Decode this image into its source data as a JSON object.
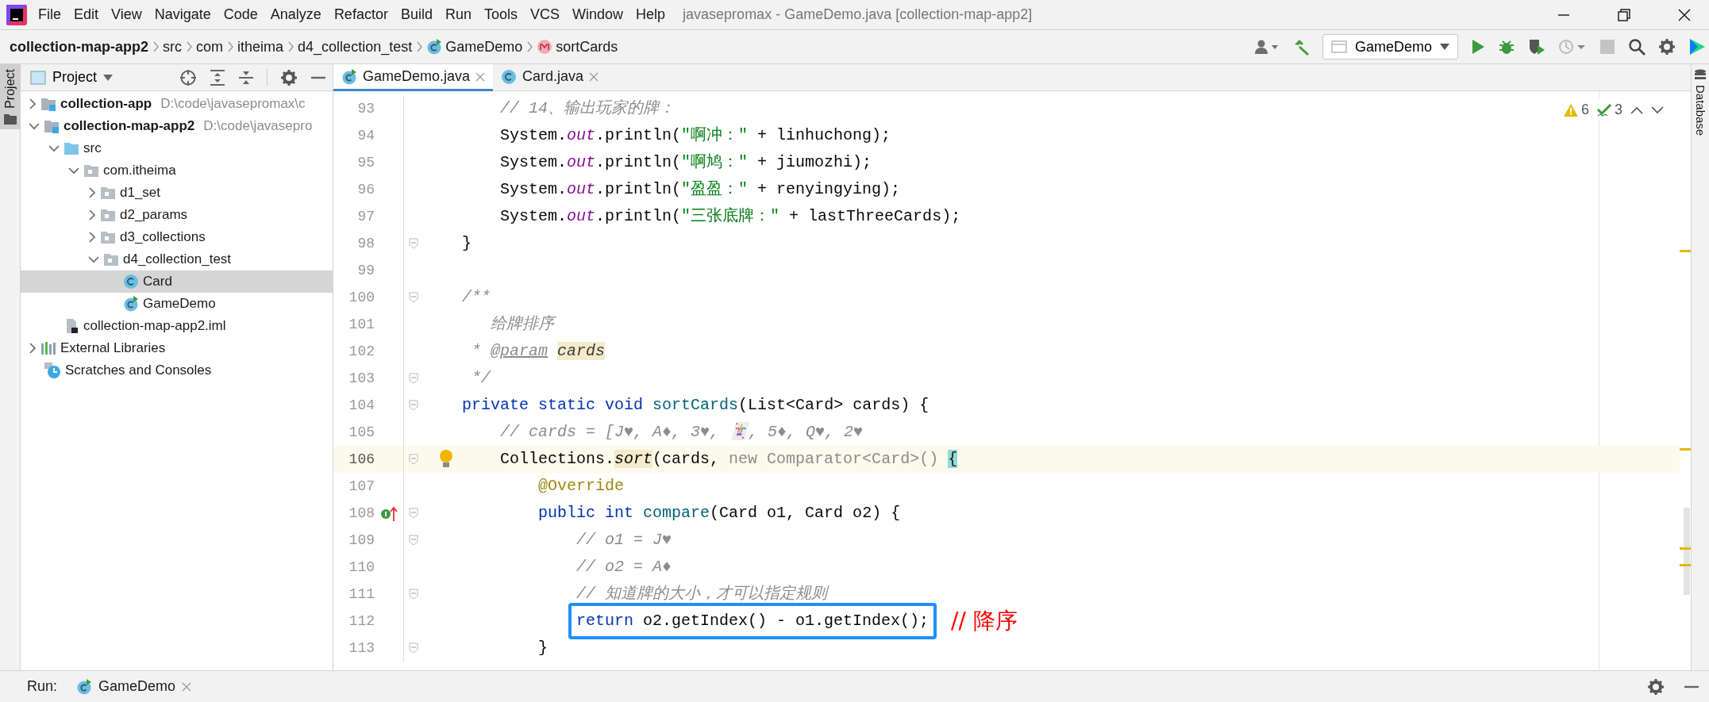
{
  "window": {
    "title": "javasepromax - GameDemo.java [collection-map-app2]"
  },
  "menu": [
    "File",
    "Edit",
    "View",
    "Navigate",
    "Code",
    "Analyze",
    "Refactor",
    "Build",
    "Run",
    "Tools",
    "VCS",
    "Window",
    "Help"
  ],
  "breadcrumbs": [
    {
      "label": "collection-map-app2",
      "kind": "module"
    },
    {
      "label": "src",
      "kind": "folder"
    },
    {
      "label": "com",
      "kind": "folder"
    },
    {
      "label": "itheima",
      "kind": "folder"
    },
    {
      "label": "d4_collection_test",
      "kind": "folder"
    },
    {
      "label": "GameDemo",
      "kind": "main-class"
    },
    {
      "label": "sortCards",
      "kind": "method"
    }
  ],
  "run_config": {
    "label": "GameDemo"
  },
  "left_stripe": {
    "label": "Project"
  },
  "right_stripe": {
    "label": "Database"
  },
  "project_panel": {
    "title": "Project",
    "tree": [
      {
        "label": "collection-app",
        "path": "D:\\code\\javasepromax\\c",
        "kind": "module",
        "expanded": false,
        "selected": false
      },
      {
        "label": "collection-map-app2",
        "path": "D:\\code\\javasepro",
        "kind": "module",
        "expanded": true,
        "selected": false,
        "children": [
          {
            "label": "src",
            "kind": "source-folder",
            "expanded": true,
            "selected": false,
            "children": [
              {
                "label": "com.itheima",
                "kind": "package",
                "expanded": true,
                "selected": false,
                "children": [
                  {
                    "label": "d1_set",
                    "kind": "package",
                    "expanded": false,
                    "selected": false
                  },
                  {
                    "label": "d2_params",
                    "kind": "package",
                    "expanded": false,
                    "selected": false
                  },
                  {
                    "label": "d3_collections",
                    "kind": "package",
                    "expanded": false,
                    "selected": false
                  },
                  {
                    "label": "d4_collection_test",
                    "kind": "package",
                    "expanded": true,
                    "selected": false,
                    "children": [
                      {
                        "label": "Card",
                        "kind": "class",
                        "selected": true
                      },
                      {
                        "label": "GameDemo",
                        "kind": "main-class",
                        "selected": false
                      }
                    ]
                  }
                ]
              }
            ]
          },
          {
            "label": "collection-map-app2.iml",
            "kind": "module-file",
            "selected": false
          }
        ]
      },
      {
        "label": "External Libraries",
        "kind": "libraries",
        "expanded": false,
        "selected": false
      },
      {
        "label": "Scratches and Consoles",
        "kind": "scratches",
        "selected": false
      }
    ]
  },
  "editor": {
    "tabs": [
      {
        "label": "GameDemo.java",
        "kind": "main-class",
        "selected": true
      },
      {
        "label": "Card.java",
        "kind": "class",
        "selected": false
      }
    ],
    "inspections": {
      "warnings": "6",
      "weak_warnings": "3"
    },
    "lines": [
      {
        "number": "93",
        "fold": false,
        "current": false,
        "boxed": false,
        "tokens": [
          {
            "kind": "comment",
            "text": "        // 14、输出玩家的牌："
          }
        ]
      },
      {
        "number": "94",
        "fold": false,
        "current": false,
        "boxed": false,
        "tokens": [
          {
            "kind": "plain",
            "text": "        System."
          },
          {
            "kind": "field",
            "text": "out"
          },
          {
            "kind": "plain",
            "text": ".println("
          },
          {
            "kind": "string",
            "text": "\"啊冲：\""
          },
          {
            "kind": "plain",
            "text": " + linhuchong);"
          }
        ]
      },
      {
        "number": "95",
        "fold": false,
        "current": false,
        "boxed": false,
        "tokens": [
          {
            "kind": "plain",
            "text": "        System."
          },
          {
            "kind": "field",
            "text": "out"
          },
          {
            "kind": "plain",
            "text": ".println("
          },
          {
            "kind": "string",
            "text": "\"啊鸠：\""
          },
          {
            "kind": "plain",
            "text": " + jiumozhi);"
          }
        ]
      },
      {
        "number": "96",
        "fold": false,
        "current": false,
        "boxed": false,
        "tokens": [
          {
            "kind": "plain",
            "text": "        System."
          },
          {
            "kind": "field",
            "text": "out"
          },
          {
            "kind": "plain",
            "text": ".println("
          },
          {
            "kind": "string",
            "text": "\"盈盈：\""
          },
          {
            "kind": "plain",
            "text": " + renyingying);"
          }
        ]
      },
      {
        "number": "97",
        "fold": false,
        "current": false,
        "boxed": false,
        "tokens": [
          {
            "kind": "plain",
            "text": "        System."
          },
          {
            "kind": "field",
            "text": "out"
          },
          {
            "kind": "plain",
            "text": ".println("
          },
          {
            "kind": "string",
            "text": "\"三张底牌：\""
          },
          {
            "kind": "plain",
            "text": " + lastThreeCards);"
          }
        ]
      },
      {
        "number": "98",
        "fold": true,
        "current": false,
        "boxed": false,
        "tokens": [
          {
            "kind": "plain",
            "text": "    }"
          }
        ]
      },
      {
        "number": "99",
        "fold": false,
        "current": false,
        "boxed": false
      },
      {
        "number": "100",
        "fold": true,
        "current": false,
        "boxed": false,
        "tokens": [
          {
            "kind": "doc",
            "text": "    /**"
          }
        ]
      },
      {
        "number": "101",
        "fold": false,
        "current": false,
        "boxed": false,
        "tokens": [
          {
            "kind": "doc",
            "text": "       给牌排序"
          }
        ]
      },
      {
        "number": "102",
        "fold": false,
        "current": false,
        "boxed": false,
        "tokens": [
          {
            "kind": "doc",
            "text": "     * "
          },
          {
            "kind": "doc-tag",
            "text": "@param "
          },
          {
            "kind": "doc-param",
            "text": "cards"
          }
        ]
      },
      {
        "number": "103",
        "fold": true,
        "current": false,
        "boxed": false,
        "tokens": [
          {
            "kind": "doc",
            "text": "     */"
          }
        ]
      },
      {
        "number": "104",
        "fold": true,
        "current": false,
        "boxed": false,
        "tokens": [
          {
            "kind": "keyword",
            "text": "    private static void "
          },
          {
            "kind": "method-decl",
            "text": "sortCards"
          },
          {
            "kind": "plain",
            "text": "(List<Card> cards) {"
          }
        ]
      },
      {
        "number": "105",
        "fold": false,
        "current": false,
        "boxed": false,
        "tokens": [
          {
            "kind": "comment",
            "text": "        // cards = [J♥, A♦, 3♥, 🃏, 5♦, Q♥, 2♥"
          }
        ]
      },
      {
        "number": "106",
        "fold": true,
        "current": true,
        "boxed": false,
        "kind": "bulb",
        "tokens": [
          {
            "kind": "plain",
            "text": "        Collections."
          },
          {
            "kind": "static-call",
            "text": "sort"
          },
          {
            "kind": "plain",
            "text": "(cards, "
          },
          {
            "kind": "hint",
            "text": "new Comparator<Card>() "
          },
          {
            "kind": "brace-match",
            "text": "{"
          }
        ]
      },
      {
        "number": "107",
        "fold": false,
        "current": false,
        "boxed": false,
        "tokens": [
          {
            "kind": "annotation",
            "text": "            @Override"
          }
        ]
      },
      {
        "number": "108",
        "fold": true,
        "current": false,
        "boxed": false,
        "kind": "implements",
        "tokens": [
          {
            "kind": "keyword",
            "text": "            public int "
          },
          {
            "kind": "method-decl",
            "text": "compare"
          },
          {
            "kind": "plain",
            "text": "(Card o1, Card o2) {"
          }
        ]
      },
      {
        "number": "109",
        "fold": true,
        "current": false,
        "boxed": false,
        "tokens": [
          {
            "kind": "comment",
            "text": "                // o1 = J♥"
          }
        ]
      },
      {
        "number": "110",
        "fold": false,
        "current": false,
        "boxed": false,
        "tokens": [
          {
            "kind": "comment",
            "text": "                // o2 = A♦"
          }
        ]
      },
      {
        "number": "111",
        "fold": true,
        "current": false,
        "boxed": false,
        "tokens": [
          {
            "kind": "comment",
            "text": "                // 知道牌的大小，才可以指定规则"
          }
        ]
      },
      {
        "number": "112",
        "fold": false,
        "current": false,
        "boxed": true,
        "note": "// 降序",
        "tokens": [
          {
            "kind": "keyword",
            "text": "                return"
          },
          {
            "kind": "plain",
            "text": " o2.getIndex() - o1.getIndex();"
          }
        ]
      },
      {
        "number": "113",
        "fold": true,
        "current": false,
        "boxed": false,
        "tokens": [
          {
            "kind": "plain",
            "text": "            }"
          }
        ]
      }
    ]
  },
  "run_bar": {
    "label": "Run:",
    "tab": "GameDemo"
  }
}
